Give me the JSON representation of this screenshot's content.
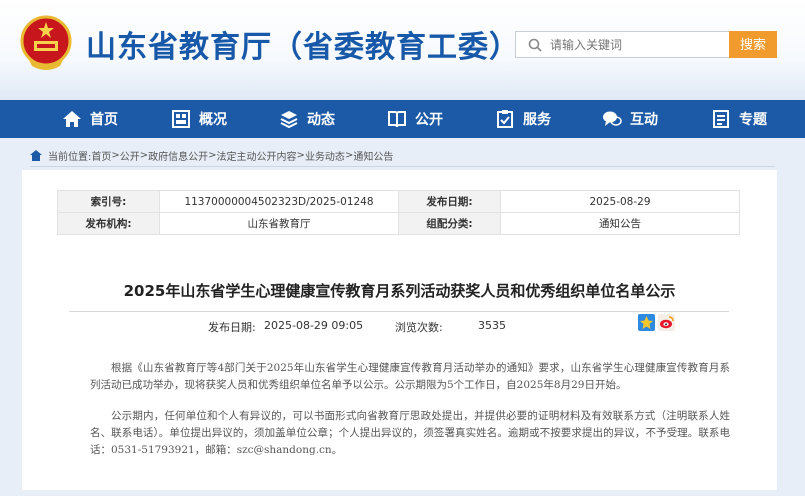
{
  "header": {
    "site_title": "山东省教育厅（省委教育工委）",
    "search_placeholder": "请输入关键词",
    "search_button": "搜索"
  },
  "nav": {
    "items": [
      {
        "label": "首页",
        "icon": "home-icon"
      },
      {
        "label": "概况",
        "icon": "overview-icon"
      },
      {
        "label": "动态",
        "icon": "news-icon"
      },
      {
        "label": "公开",
        "icon": "book-icon"
      },
      {
        "label": "服务",
        "icon": "service-icon"
      },
      {
        "label": "互动",
        "icon": "chat-icon"
      },
      {
        "label": "专题",
        "icon": "topic-icon"
      }
    ]
  },
  "breadcrumb": {
    "prefix": "当前位置:",
    "items": [
      "首页",
      "公开",
      "政府信息公开",
      "法定主动公开内容",
      "业务动态",
      "通知公告"
    ],
    "separator": ">"
  },
  "meta": {
    "index_label": "索引号:",
    "index_value": "11370000004502323D/2025-01248",
    "date_label": "发布日期:",
    "date_value": "2025-08-29",
    "org_label": "发布机构:",
    "org_value": "山东省教育厅",
    "category_label": "组配分类:",
    "category_value": "通知公告"
  },
  "article": {
    "title": "2025年山东省学生心理健康宣传教育月系列活动获奖人员和优秀组织单位名单公示",
    "publish_label": "发布日期:",
    "publish_value": "2025-08-29 09:05",
    "views_label": "浏览次数:",
    "views_value": "3535",
    "paragraphs": [
      "根据《山东省教育厅等4部门关于2025年山东省学生心理健康宣传教育月活动举办的通知》要求，山东省学生心理健康宣传教育月系列活动已成功举办，现将获奖人员和优秀组织单位名单予以公示。公示期限为5个工作日，自2025年8月29日开始。",
      "公示期内，任何单位和个人有异议的，可以书面形式向省教育厅思政处提出，并提供必要的证明材料及有效联系方式（注明联系人姓名、联系电话）。单位提出异议的，须加盖单位公章；个人提出异议的，须签署真实姓名。逾期或不按要求提出的异议，不予受理。联系电话：0531-51793921，邮箱：szc@shandong.cn。"
    ]
  },
  "colors": {
    "brand_blue": "#1c5aa7",
    "title_blue": "#1759a8",
    "search_orange": "#f19a2e"
  }
}
